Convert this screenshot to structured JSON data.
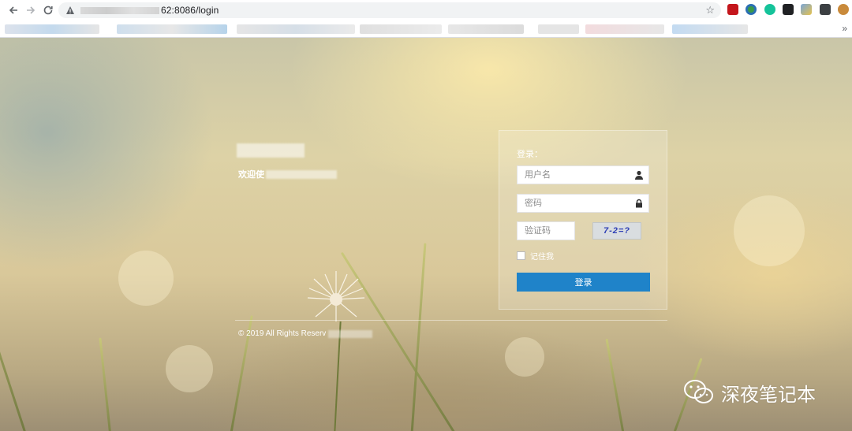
{
  "browser": {
    "url_visible": "62:8086/login",
    "more_bookmarks": "»"
  },
  "login_page": {
    "welcome_prefix": "欢迎使",
    "form": {
      "title": "登录：",
      "username_placeholder": "用户名",
      "password_placeholder": "密码",
      "captcha_placeholder": "验证码",
      "captcha_image_text": "7-2=?",
      "remember_label": "记住我",
      "submit_label": "登录"
    },
    "footer": "© 2019 All Rights Reserv"
  },
  "watermark": {
    "text": "深夜笔记本"
  },
  "colors": {
    "primary_button": "#1f83c9"
  }
}
